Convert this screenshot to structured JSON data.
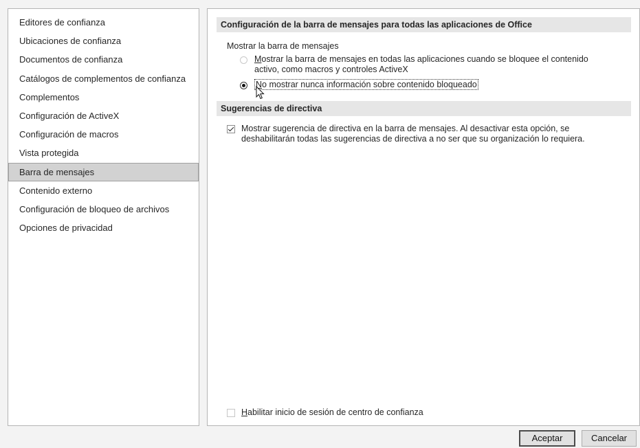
{
  "sidebar": {
    "items": [
      {
        "label": "Editores de confianza"
      },
      {
        "label": "Ubicaciones de confianza"
      },
      {
        "label": "Documentos de confianza"
      },
      {
        "label": "Catálogos de complementos de confianza"
      },
      {
        "label": "Complementos"
      },
      {
        "label": "Configuración de ActiveX"
      },
      {
        "label": "Configuración de macros"
      },
      {
        "label": "Vista protegida"
      },
      {
        "label": "Barra de mensajes"
      },
      {
        "label": "Contenido externo"
      },
      {
        "label": "Configuración de bloqueo de archivos"
      },
      {
        "label": "Opciones de privacidad"
      }
    ],
    "selected_label": "Barra de mensajes"
  },
  "message_bar_section": {
    "header": "Configuración de la barra de mensajes para todas las aplicaciones de Office",
    "group_label": "Mostrar la barra de mensajes",
    "option_show": {
      "first_letter": "M",
      "rest": "ostrar la barra de mensajes en todas las aplicaciones cuando se bloquee el contenido activo, como macros y controles ActiveX",
      "checked": false
    },
    "option_never": {
      "first_letter": "N",
      "rest": "o mostrar nunca información sobre contenido bloqueado",
      "checked": true
    }
  },
  "policy_section": {
    "header": "Sugerencias de directiva",
    "checkbox_label": "Mostrar sugerencia de directiva en la barra de mensajes. Al desactivar esta opción, se deshabilitarán todas las sugerencias de directiva a no ser que su organización lo requiera.",
    "checked": true
  },
  "logging": {
    "first_letter": "H",
    "rest": "abilitar inicio de sesión de centro de confianza",
    "checked": false
  },
  "buttons": {
    "ok": "Aceptar",
    "cancel": "Cancelar"
  }
}
